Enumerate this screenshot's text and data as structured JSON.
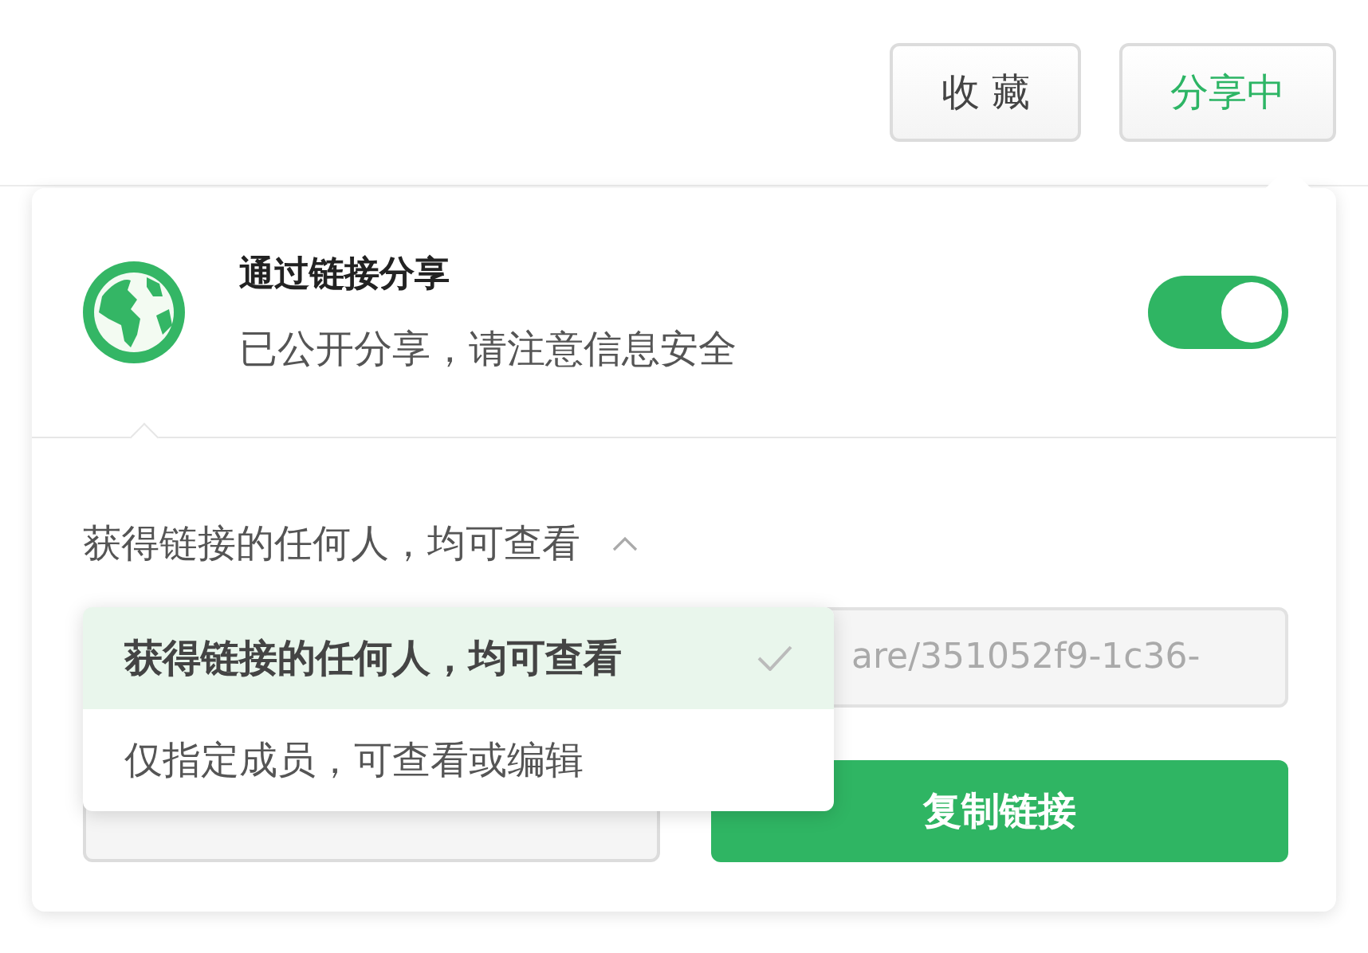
{
  "header_buttons": [
    {
      "label": "收 藏",
      "active": false
    },
    {
      "label": "分享中",
      "active": true
    }
  ],
  "share": {
    "title": "通过链接分享",
    "subtitle": "已公开分享，请注意信息安全",
    "on": true
  },
  "access": {
    "label": "获得链接的任何人，均可查看",
    "expanded": true,
    "options": [
      {
        "label": "获得链接的任何人，均可查看",
        "selected": true
      },
      {
        "label": "仅指定成员，可查看或编辑",
        "selected": false
      }
    ]
  },
  "link_field": {
    "value": "are/351052f9-1c36-"
  },
  "actions": [
    {
      "kind": "secondary"
    },
    {
      "label": "复制链接",
      "kind": "primary"
    }
  ]
}
